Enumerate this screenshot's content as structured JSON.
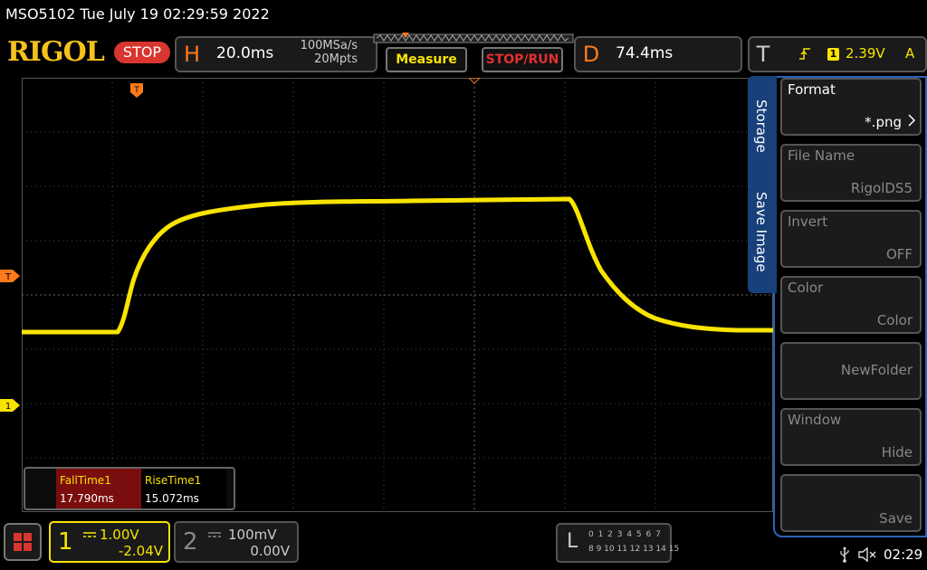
{
  "header": {
    "title": "MSO5102  Tue July 19 02:29:59 2022",
    "logo": "RIGOL",
    "run_status": "STOP"
  },
  "horizontal": {
    "letter": "H",
    "timebase": "20.0ms",
    "sample_rate": "100MSa/s",
    "memory_depth": "20Mpts"
  },
  "buttons": {
    "measure": "Measure",
    "stop_run": "STOP/RUN"
  },
  "delay": {
    "letter": "D",
    "value": "74.4ms"
  },
  "trigger": {
    "letter": "T",
    "source_channel": "1",
    "level": "2.39V",
    "mode": "A"
  },
  "markers": {
    "trigger_position": "T",
    "trigger_level": "T",
    "channel1": "1"
  },
  "measurements": [
    {
      "name": "FallTime1",
      "value": "17.790ms"
    },
    {
      "name": "RiseTime1",
      "value": "15.072ms"
    }
  ],
  "side_menu": {
    "tab_storage": "Storage",
    "tab_save_image": "Save Image",
    "items": [
      {
        "label": "Format",
        "value": "*.png",
        "enabled": true
      },
      {
        "label": "File Name",
        "value": "RigolDS5",
        "enabled": false
      },
      {
        "label": "Invert",
        "value": "OFF",
        "enabled": false
      },
      {
        "label": "Color",
        "value": "Color",
        "enabled": false
      },
      {
        "label": "",
        "value": "NewFolder",
        "enabled": false
      },
      {
        "label": "Window",
        "value": "Hide",
        "enabled": false
      },
      {
        "label": "",
        "value": "Save",
        "enabled": false
      }
    ]
  },
  "channels": [
    {
      "number": "1",
      "scale": "1.00V",
      "offset": "-2.04V",
      "color": "#f8e400",
      "active": true
    },
    {
      "number": "2",
      "scale": "100mV",
      "offset": "0.00V",
      "color": "#888888",
      "active": false
    }
  ],
  "logic_analyzer": {
    "letter": "L",
    "row1": "0 1 2 3  4 5 6 7",
    "row2": "8 9 10 11 12 13 14 15"
  },
  "status": {
    "time": "02:29",
    "icons": [
      "usb-icon",
      "speaker-muted-icon"
    ]
  },
  "colors": {
    "trace": "#f8e400",
    "accent_orange": "#ff7a1a",
    "menu_blue": "#2b62b8"
  }
}
